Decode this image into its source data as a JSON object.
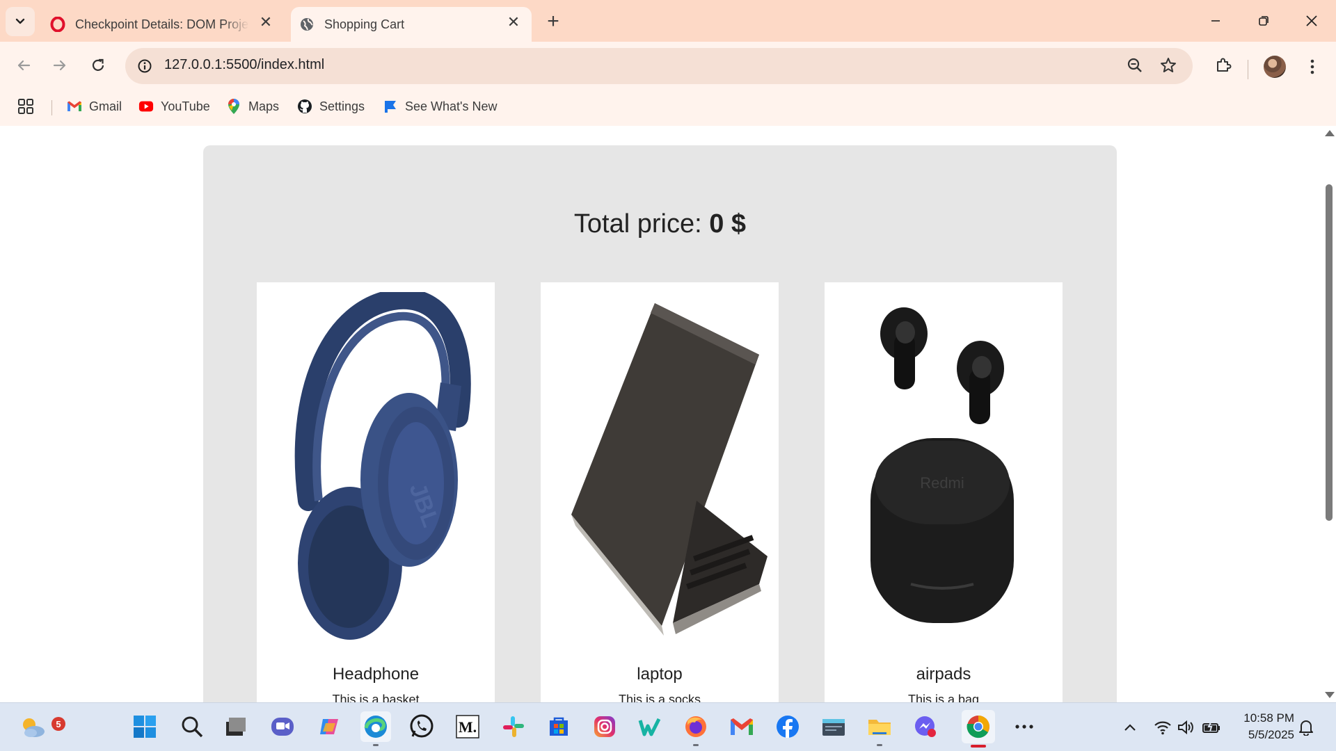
{
  "browser": {
    "tabs": [
      {
        "title": "Checkpoint Details: DOM Project",
        "active": false
      },
      {
        "title": "Shopping Cart",
        "active": true
      }
    ],
    "address_bar": {
      "url": "127.0.0.1:5500/index.html"
    },
    "bookmarks": [
      {
        "label": "Gmail",
        "icon": "gmail-icon"
      },
      {
        "label": "YouTube",
        "icon": "youtube-icon"
      },
      {
        "label": "Maps",
        "icon": "maps-icon"
      },
      {
        "label": "Settings",
        "icon": "github-icon"
      },
      {
        "label": "See What's New",
        "icon": "flag-icon"
      }
    ]
  },
  "page": {
    "total_label": "Total price:",
    "total_value": "0 $",
    "products": [
      {
        "name": "Headphone",
        "description": "This is a basket",
        "image": "headphone-image"
      },
      {
        "name": "laptop",
        "description": "This is a socks",
        "image": "laptop-image"
      },
      {
        "name": "airpads",
        "description": "This is a bag",
        "image": "earbuds-image",
        "image_text": "Redmi"
      }
    ]
  },
  "taskbar": {
    "weather_badge": "5",
    "clock": {
      "time": "10:58 PM",
      "date": "5/5/2025"
    }
  },
  "colors": {
    "tabstrip": "#fdd9c6",
    "toolbar": "#fff3ed",
    "panel": "#e6e6e6",
    "taskbar": "#dde6f3"
  }
}
